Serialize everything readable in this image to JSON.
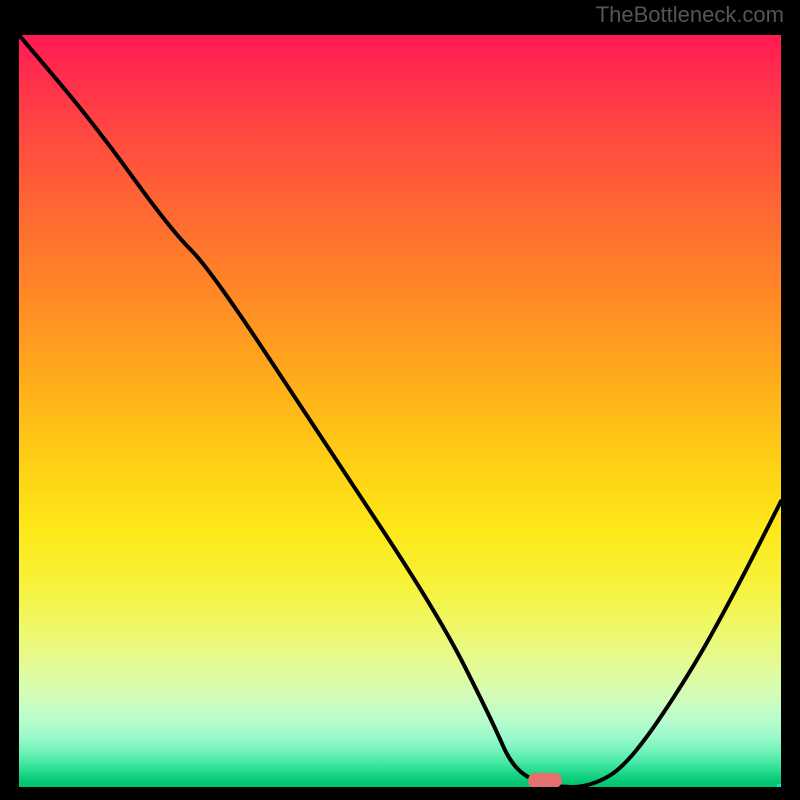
{
  "watermark": "TheBottleneck.com",
  "chart_data": {
    "type": "line",
    "title": "",
    "xlabel": "",
    "ylabel": "",
    "xlim": [
      0,
      100
    ],
    "ylim": [
      0,
      100
    ],
    "series": [
      {
        "name": "bottleneck-curve",
        "x": [
          0,
          10,
          20,
          25,
          40,
          55,
          62,
          65,
          70,
          75,
          80,
          88,
          94,
          100
        ],
        "values": [
          100,
          88,
          74,
          69,
          46,
          23,
          9,
          2,
          0,
          0,
          3,
          15,
          26,
          38
        ]
      }
    ],
    "marker": {
      "x_center": 69,
      "y": 0,
      "width_pct": 4.4
    },
    "background": "heat-gradient-red-to-green-vertical"
  }
}
